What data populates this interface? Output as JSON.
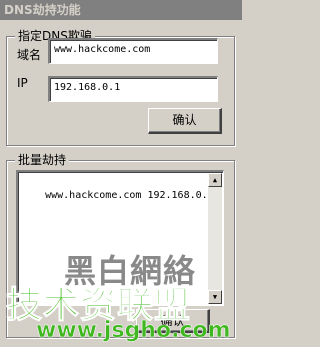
{
  "window": {
    "title": "DNS劫持功能"
  },
  "spoof_group": {
    "title": "指定DNS欺骗",
    "domain_label": "域名",
    "domain_value": "www.hackcome.com",
    "ip_label": "IP",
    "ip_value": "192.168.0.1",
    "confirm_label": "确认"
  },
  "batch_group": {
    "title": "批量劫持",
    "entries": "www.hackcome.com 192.168.0.1",
    "confirm_label": "确认"
  },
  "watermark": {
    "line1": "黑白網絡",
    "line2": "技术资联盟",
    "url": "www.jsgho.com"
  },
  "icons": {
    "scroll_up": "scroll-up-arrow",
    "scroll_down": "scroll-down-arrow"
  }
}
